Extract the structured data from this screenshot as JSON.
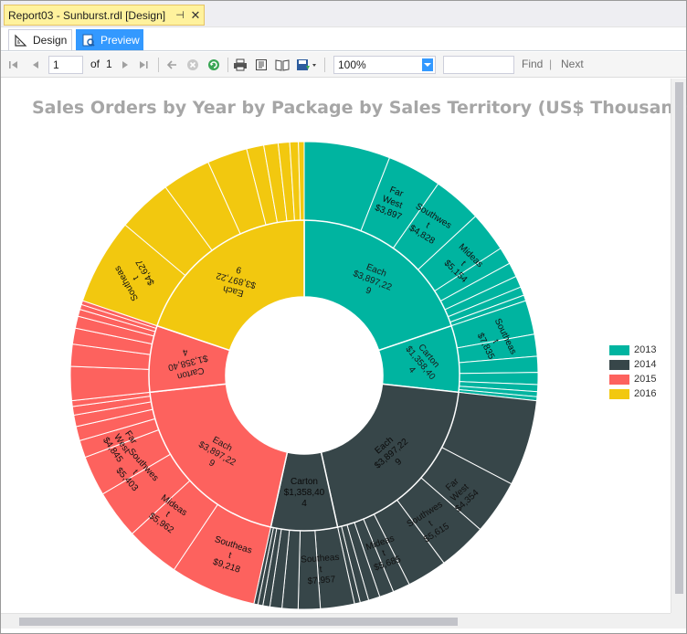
{
  "window": {
    "doc_tab_title": "Report03 - Sunburst.rdl [Design]",
    "doc_tab_pin": "⊣",
    "doc_tab_close": "✕"
  },
  "view_tabs": {
    "design_label": "Design",
    "preview_label": "Preview"
  },
  "toolbar": {
    "page_current": "1",
    "page_of_label": "of",
    "page_total": "1",
    "zoom_value": "100%",
    "find_label": "Find",
    "find_separator": "|",
    "next_label": "Next"
  },
  "colors": {
    "2013": "#00b4a0",
    "2014": "#374649",
    "2015": "#fd625e",
    "2016": "#f2c80f"
  },
  "chart_data": {
    "type": "sunburst",
    "title": "Sales Orders by Year by Package by Sales Territory (US$ Thousands)",
    "legend": {
      "position": "right",
      "entries": [
        "2013",
        "2014",
        "2015",
        "2016"
      ]
    },
    "rings": [
      {
        "level": "Year",
        "segments": [
          {
            "year": "2013",
            "value": 5256
          },
          {
            "year": "2014",
            "value": 5256
          },
          {
            "year": "2015",
            "value": 5256
          },
          {
            "year": "2016",
            "value": 3897
          }
        ]
      },
      {
        "level": "Package",
        "segments": [
          {
            "year": "2015",
            "label": "Each\n$3,897,22\n9",
            "value": 3897
          },
          {
            "year": "2015",
            "label": "Carton\n$1,358,40\n4",
            "value": 1358
          },
          {
            "year": "2014",
            "label": "Each\n$3,897,22\n9",
            "value": 3897
          },
          {
            "year": "2014",
            "label": "Carton\n$1,358,40\n4",
            "value": 1358
          },
          {
            "year": "2013",
            "label": "Each\n$3,897,22\n9",
            "value": 3897
          },
          {
            "year": "2013",
            "label": "Carton\n$1,358,40\n4",
            "value": 1358
          },
          {
            "year": "2016",
            "label": "Each\n$3,897,22\n9",
            "value": 3897
          }
        ]
      }
    ],
    "territory_labels": [
      {
        "year": "2015",
        "text": "Southeas\nt\n$9,218"
      },
      {
        "year": "2015",
        "text": "Mideas\nt\n$5,962"
      },
      {
        "year": "2015",
        "text": "Southwes\nt\n$5,403"
      },
      {
        "year": "2015",
        "text": "Far\nWest\n$4,845"
      },
      {
        "year": "2014",
        "text": "Southeas\nt\n$7,957"
      },
      {
        "year": "2014",
        "text": "Mideas\nt\n$5,685"
      },
      {
        "year": "2014",
        "text": "Southwes\nt\n$5,615"
      },
      {
        "year": "2014",
        "text": "Far\nWest\n$4,354"
      },
      {
        "year": "2013",
        "text": "Southeas\nt\n$7,835"
      },
      {
        "year": "2013",
        "text": "Mideas\nt\n$5,154"
      },
      {
        "year": "2013",
        "text": "Southwes\nt\n$4,828"
      },
      {
        "year": "2013",
        "text": "Far\nWest\n$3,897"
      },
      {
        "year": "2016",
        "text": "Southeas\nt\n$4,627"
      }
    ]
  }
}
